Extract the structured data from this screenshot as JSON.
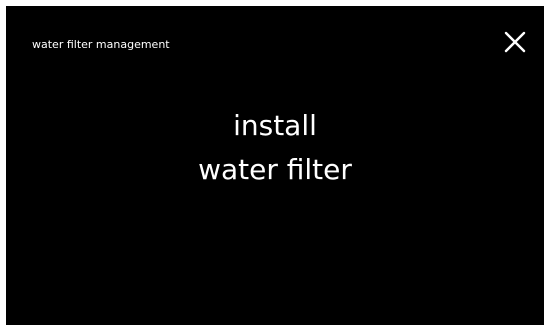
{
  "header": {
    "title": "water filter management",
    "close_icon": "close-icon"
  },
  "main": {
    "message_line_1": "install",
    "message_line_2": "water filter"
  },
  "colors": {
    "screen_background": "#000000",
    "text": "#ffffff"
  }
}
